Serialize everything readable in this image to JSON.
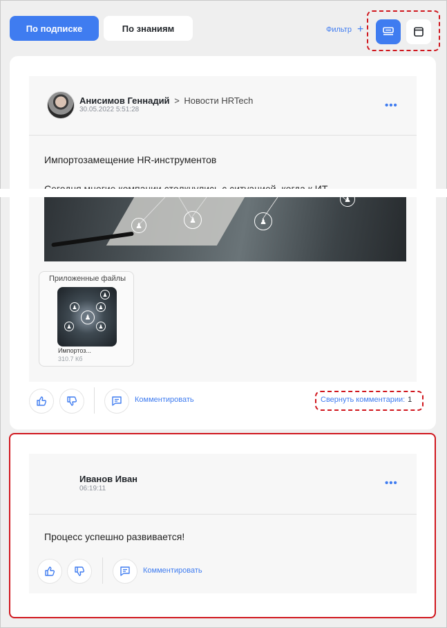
{
  "tabs": [
    {
      "label": "По подписке",
      "active": true
    },
    {
      "label": "По знаниям",
      "active": false
    }
  ],
  "filter": {
    "label": "Фильтр",
    "plus": "+"
  },
  "view_toggle": {
    "active": "list",
    "icons": [
      "list-view-icon",
      "card-view-icon"
    ]
  },
  "colors": {
    "accent": "#3f7cf0",
    "highlight": "#d0161d"
  },
  "post": {
    "author": "Анисимов Геннадий",
    "separator": ">",
    "channel": "Новости HRTech",
    "date": "30.05.2022 5:51:28",
    "menu": "•••",
    "title": "Импортозамещение HR-инструментов",
    "text": "Сегодня многие компании столкнулись с ситуацией, когда к ИТ-",
    "attachments": {
      "title": "Приложенные файлы",
      "file_name": "Импортоз...",
      "file_size": "310.7 Кб"
    },
    "actions": {
      "comment_label": "Комментировать",
      "collapse_label": "Свернуть комментарии:",
      "comments_count": "1"
    }
  },
  "comment": {
    "author": "Иванов Иван",
    "time": "06:19:11",
    "menu": "•••",
    "text": "Процесс успешно развивается!",
    "comment_label": "Комментировать"
  }
}
